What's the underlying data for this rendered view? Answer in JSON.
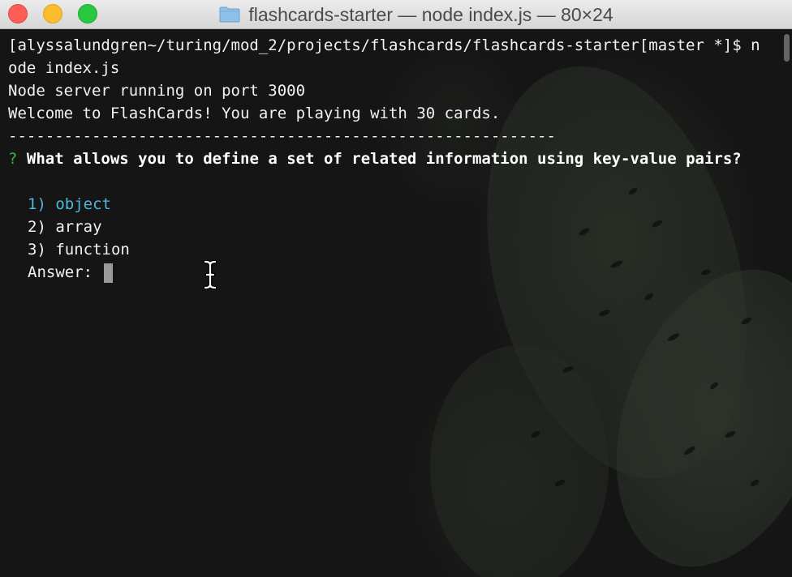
{
  "window": {
    "title": "flashcards-starter — node index.js — 80×24"
  },
  "terminal": {
    "prompt_line_1": "[alyssalundgren~/turing/mod_2/projects/flashcards/flashcards-starter[master *]$ n",
    "prompt_line_2": "ode index.js",
    "server_msg": "Node server running on port 3000",
    "welcome_msg": "Welcome to FlashCards! You are playing with 30 cards.",
    "divider": "-----------------------------------------------------------",
    "question_mark": "?",
    "question": "What allows you to define a set of related information using key-value pairs?",
    "options": [
      "1) object",
      "2) array",
      "3) function"
    ],
    "selected_option_index": 0,
    "answer_label": "Answer:",
    "answer_value": ""
  },
  "colors": {
    "selected_option": "#4cb8d8",
    "question_mark": "#3ab24a",
    "text": "#f2f2f2"
  },
  "icons": {
    "title_icon": "folder-icon",
    "pointer": "i-beam-cursor-icon"
  }
}
